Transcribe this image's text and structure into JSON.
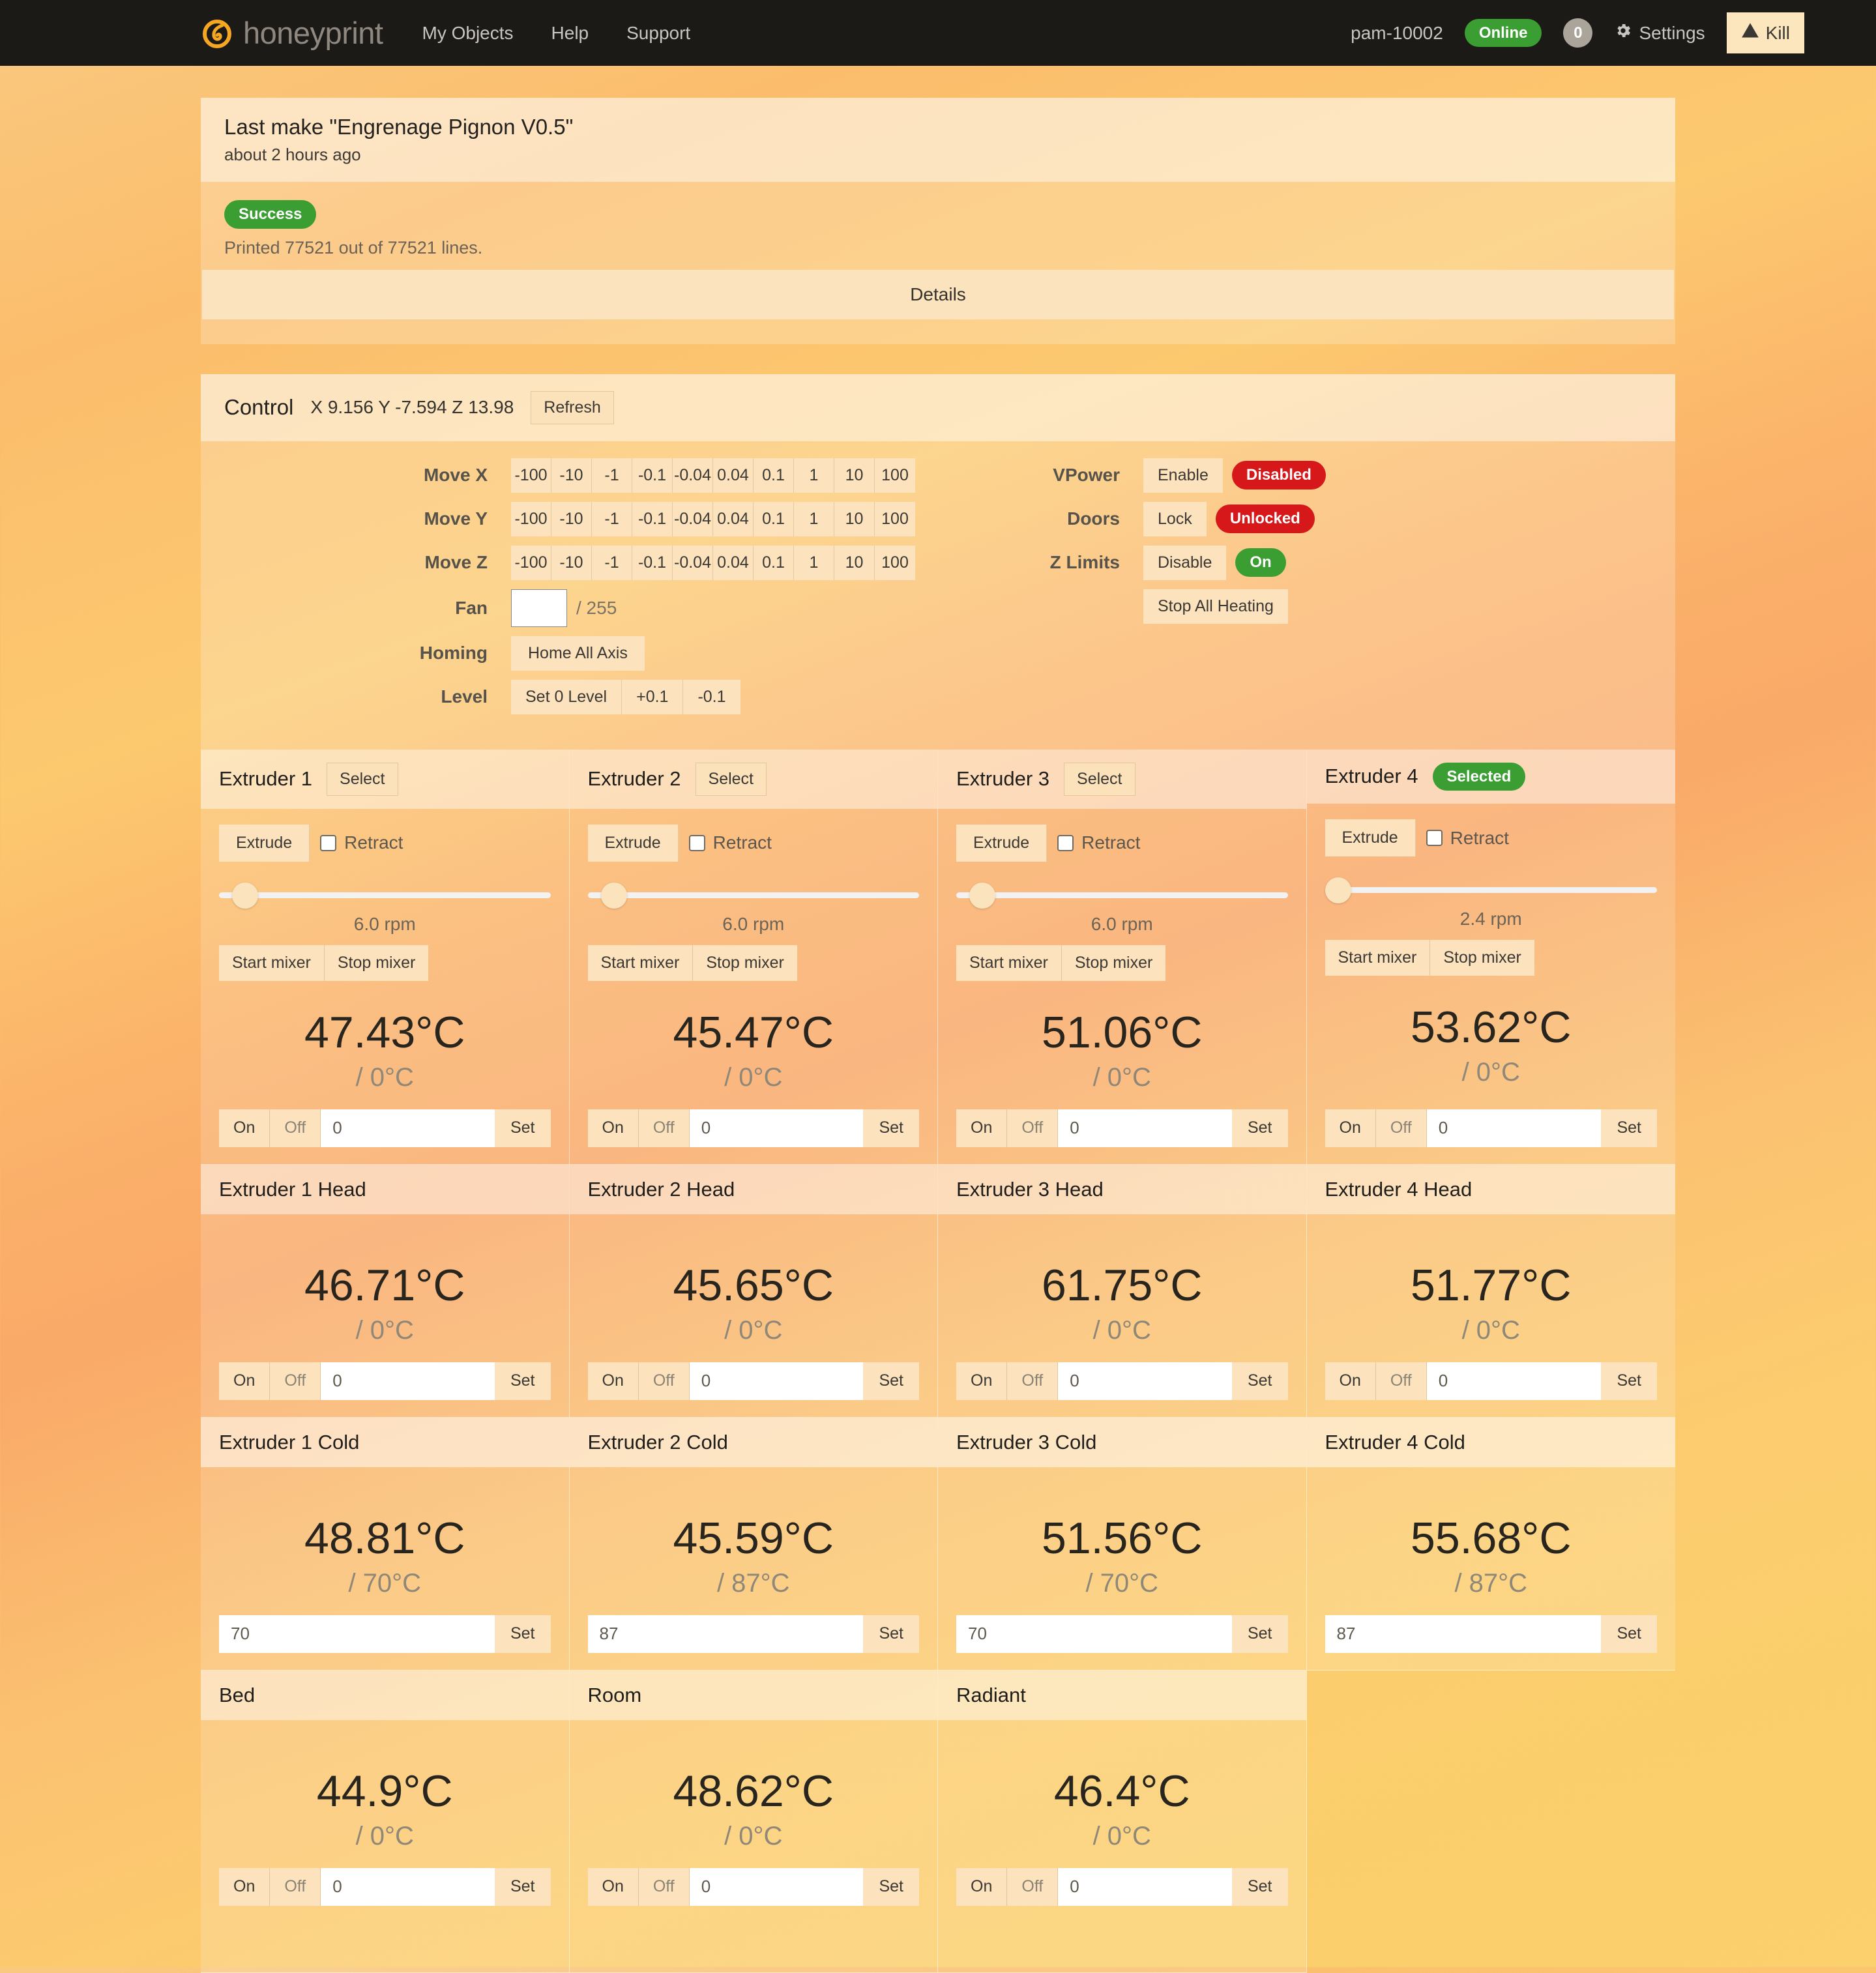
{
  "navbar": {
    "logo_icon": "honeyprint-swirl-icon",
    "brand": "honeyprint",
    "links": [
      "My Objects",
      "Help",
      "Support"
    ],
    "user": "pam-10002",
    "status": "Online",
    "status_color": "#3a9e33",
    "notification_count": "0",
    "settings_label": "Settings",
    "settings_icon": "gear-icon",
    "kill_label": "Kill",
    "kill_icon": "warning-triangle-icon"
  },
  "last_make": {
    "title": "Last make \"Engrenage Pignon V0.5\"",
    "time_ago": "about 2 hours ago",
    "status_badge": "Success",
    "status_color": "#3a9e33",
    "printed_text": "Printed 77521 out of 77521 lines.",
    "details_label": "Details"
  },
  "control": {
    "title": "Control",
    "position": "X 9.156 Y -7.594 Z 13.98",
    "refresh_label": "Refresh",
    "axes": [
      {
        "label": "Move X",
        "steps": [
          "-100",
          "-10",
          "-1",
          "-0.1",
          "-0.04",
          "0.04",
          "0.1",
          "1",
          "10",
          "100"
        ]
      },
      {
        "label": "Move Y",
        "steps": [
          "-100",
          "-10",
          "-1",
          "-0.1",
          "-0.04",
          "0.04",
          "0.1",
          "1",
          "10",
          "100"
        ]
      },
      {
        "label": "Move Z",
        "steps": [
          "-100",
          "-10",
          "-1",
          "-0.1",
          "-0.04",
          "0.04",
          "0.1",
          "1",
          "10",
          "100"
        ]
      }
    ],
    "fan": {
      "label": "Fan",
      "value": "",
      "max_text": "/ 255"
    },
    "homing": {
      "label": "Homing",
      "button": "Home All Axis"
    },
    "level": {
      "label": "Level",
      "buttons": [
        "Set 0 Level",
        "+0.1",
        "-0.1"
      ]
    },
    "vpower": {
      "label": "VPower",
      "button": "Enable",
      "state": "Disabled",
      "state_color": "#d6181b"
    },
    "doors": {
      "label": "Doors",
      "button": "Lock",
      "state": "Unlocked",
      "state_color": "#d6181b"
    },
    "zlimits": {
      "label": "Z Limits",
      "button": "Disable",
      "state": "On",
      "state_color": "#3a9e33"
    },
    "stop_all_heating": "Stop All Heating"
  },
  "extruders": [
    {
      "title": "Extruder 1",
      "action_label": "Select",
      "action_kind": "button",
      "extrude_label": "Extrude",
      "retract_label": "Retract",
      "retract_checked": false,
      "slider_pct": 4,
      "rpm": "6.0 rpm",
      "start_mixer": "Start mixer",
      "stop_mixer": "Stop mixer",
      "temp": "47.43°C",
      "target": "/ 0°C",
      "on_label": "On",
      "off_label": "Off",
      "set_value": "0",
      "set_label": "Set"
    },
    {
      "title": "Extruder 2",
      "action_label": "Select",
      "action_kind": "button",
      "extrude_label": "Extrude",
      "retract_label": "Retract",
      "retract_checked": false,
      "slider_pct": 4,
      "rpm": "6.0 rpm",
      "start_mixer": "Start mixer",
      "stop_mixer": "Stop mixer",
      "temp": "45.47°C",
      "target": "/ 0°C",
      "on_label": "On",
      "off_label": "Off",
      "set_value": "0",
      "set_label": "Set"
    },
    {
      "title": "Extruder 3",
      "action_label": "Select",
      "action_kind": "button",
      "extrude_label": "Extrude",
      "retract_label": "Retract",
      "retract_checked": false,
      "slider_pct": 4,
      "rpm": "6.0 rpm",
      "start_mixer": "Start mixer",
      "stop_mixer": "Stop mixer",
      "temp": "51.06°C",
      "target": "/ 0°C",
      "on_label": "On",
      "off_label": "Off",
      "set_value": "0",
      "set_label": "Set"
    },
    {
      "title": "Extruder 4",
      "action_label": "Selected",
      "action_kind": "badge",
      "badge_color": "#3a9e33",
      "extrude_label": "Extrude",
      "retract_label": "Retract",
      "retract_checked": false,
      "slider_pct": 0,
      "rpm": "2.4 rpm",
      "start_mixer": "Start mixer",
      "stop_mixer": "Stop mixer",
      "temp": "53.62°C",
      "target": "/ 0°C",
      "on_label": "On",
      "off_label": "Off",
      "set_value": "0",
      "set_label": "Set"
    }
  ],
  "heads": [
    {
      "title": "Extruder 1 Head",
      "temp": "46.71°C",
      "target": "/ 0°C",
      "on_label": "On",
      "off_label": "Off",
      "set_value": "0",
      "set_label": "Set"
    },
    {
      "title": "Extruder 2 Head",
      "temp": "45.65°C",
      "target": "/ 0°C",
      "on_label": "On",
      "off_label": "Off",
      "set_value": "0",
      "set_label": "Set"
    },
    {
      "title": "Extruder 3 Head",
      "temp": "61.75°C",
      "target": "/ 0°C",
      "on_label": "On",
      "off_label": "Off",
      "set_value": "0",
      "set_label": "Set"
    },
    {
      "title": "Extruder 4 Head",
      "temp": "51.77°C",
      "target": "/ 0°C",
      "on_label": "On",
      "off_label": "Off",
      "set_value": "0",
      "set_label": "Set"
    }
  ],
  "colds": [
    {
      "title": "Extruder 1 Cold",
      "temp": "48.81°C",
      "target": "/ 70°C",
      "set_value": "70",
      "set_label": "Set"
    },
    {
      "title": "Extruder 2 Cold",
      "temp": "45.59°C",
      "target": "/ 87°C",
      "set_value": "87",
      "set_label": "Set"
    },
    {
      "title": "Extruder 3 Cold",
      "temp": "51.56°C",
      "target": "/ 70°C",
      "set_value": "70",
      "set_label": "Set"
    },
    {
      "title": "Extruder 4 Cold",
      "temp": "55.68°C",
      "target": "/ 87°C",
      "set_value": "87",
      "set_label": "Set"
    }
  ],
  "environment": [
    {
      "title": "Bed",
      "temp": "44.9°C",
      "target": "/ 0°C",
      "on_label": "On",
      "off_label": "Off",
      "set_value": "0",
      "set_label": "Set"
    },
    {
      "title": "Room",
      "temp": "48.62°C",
      "target": "/ 0°C",
      "on_label": "On",
      "off_label": "Off",
      "set_value": "0",
      "set_label": "Set"
    },
    {
      "title": "Radiant",
      "temp": "46.4°C",
      "target": "/ 0°C",
      "on_label": "On",
      "off_label": "Off",
      "set_value": "0",
      "set_label": "Set"
    }
  ]
}
